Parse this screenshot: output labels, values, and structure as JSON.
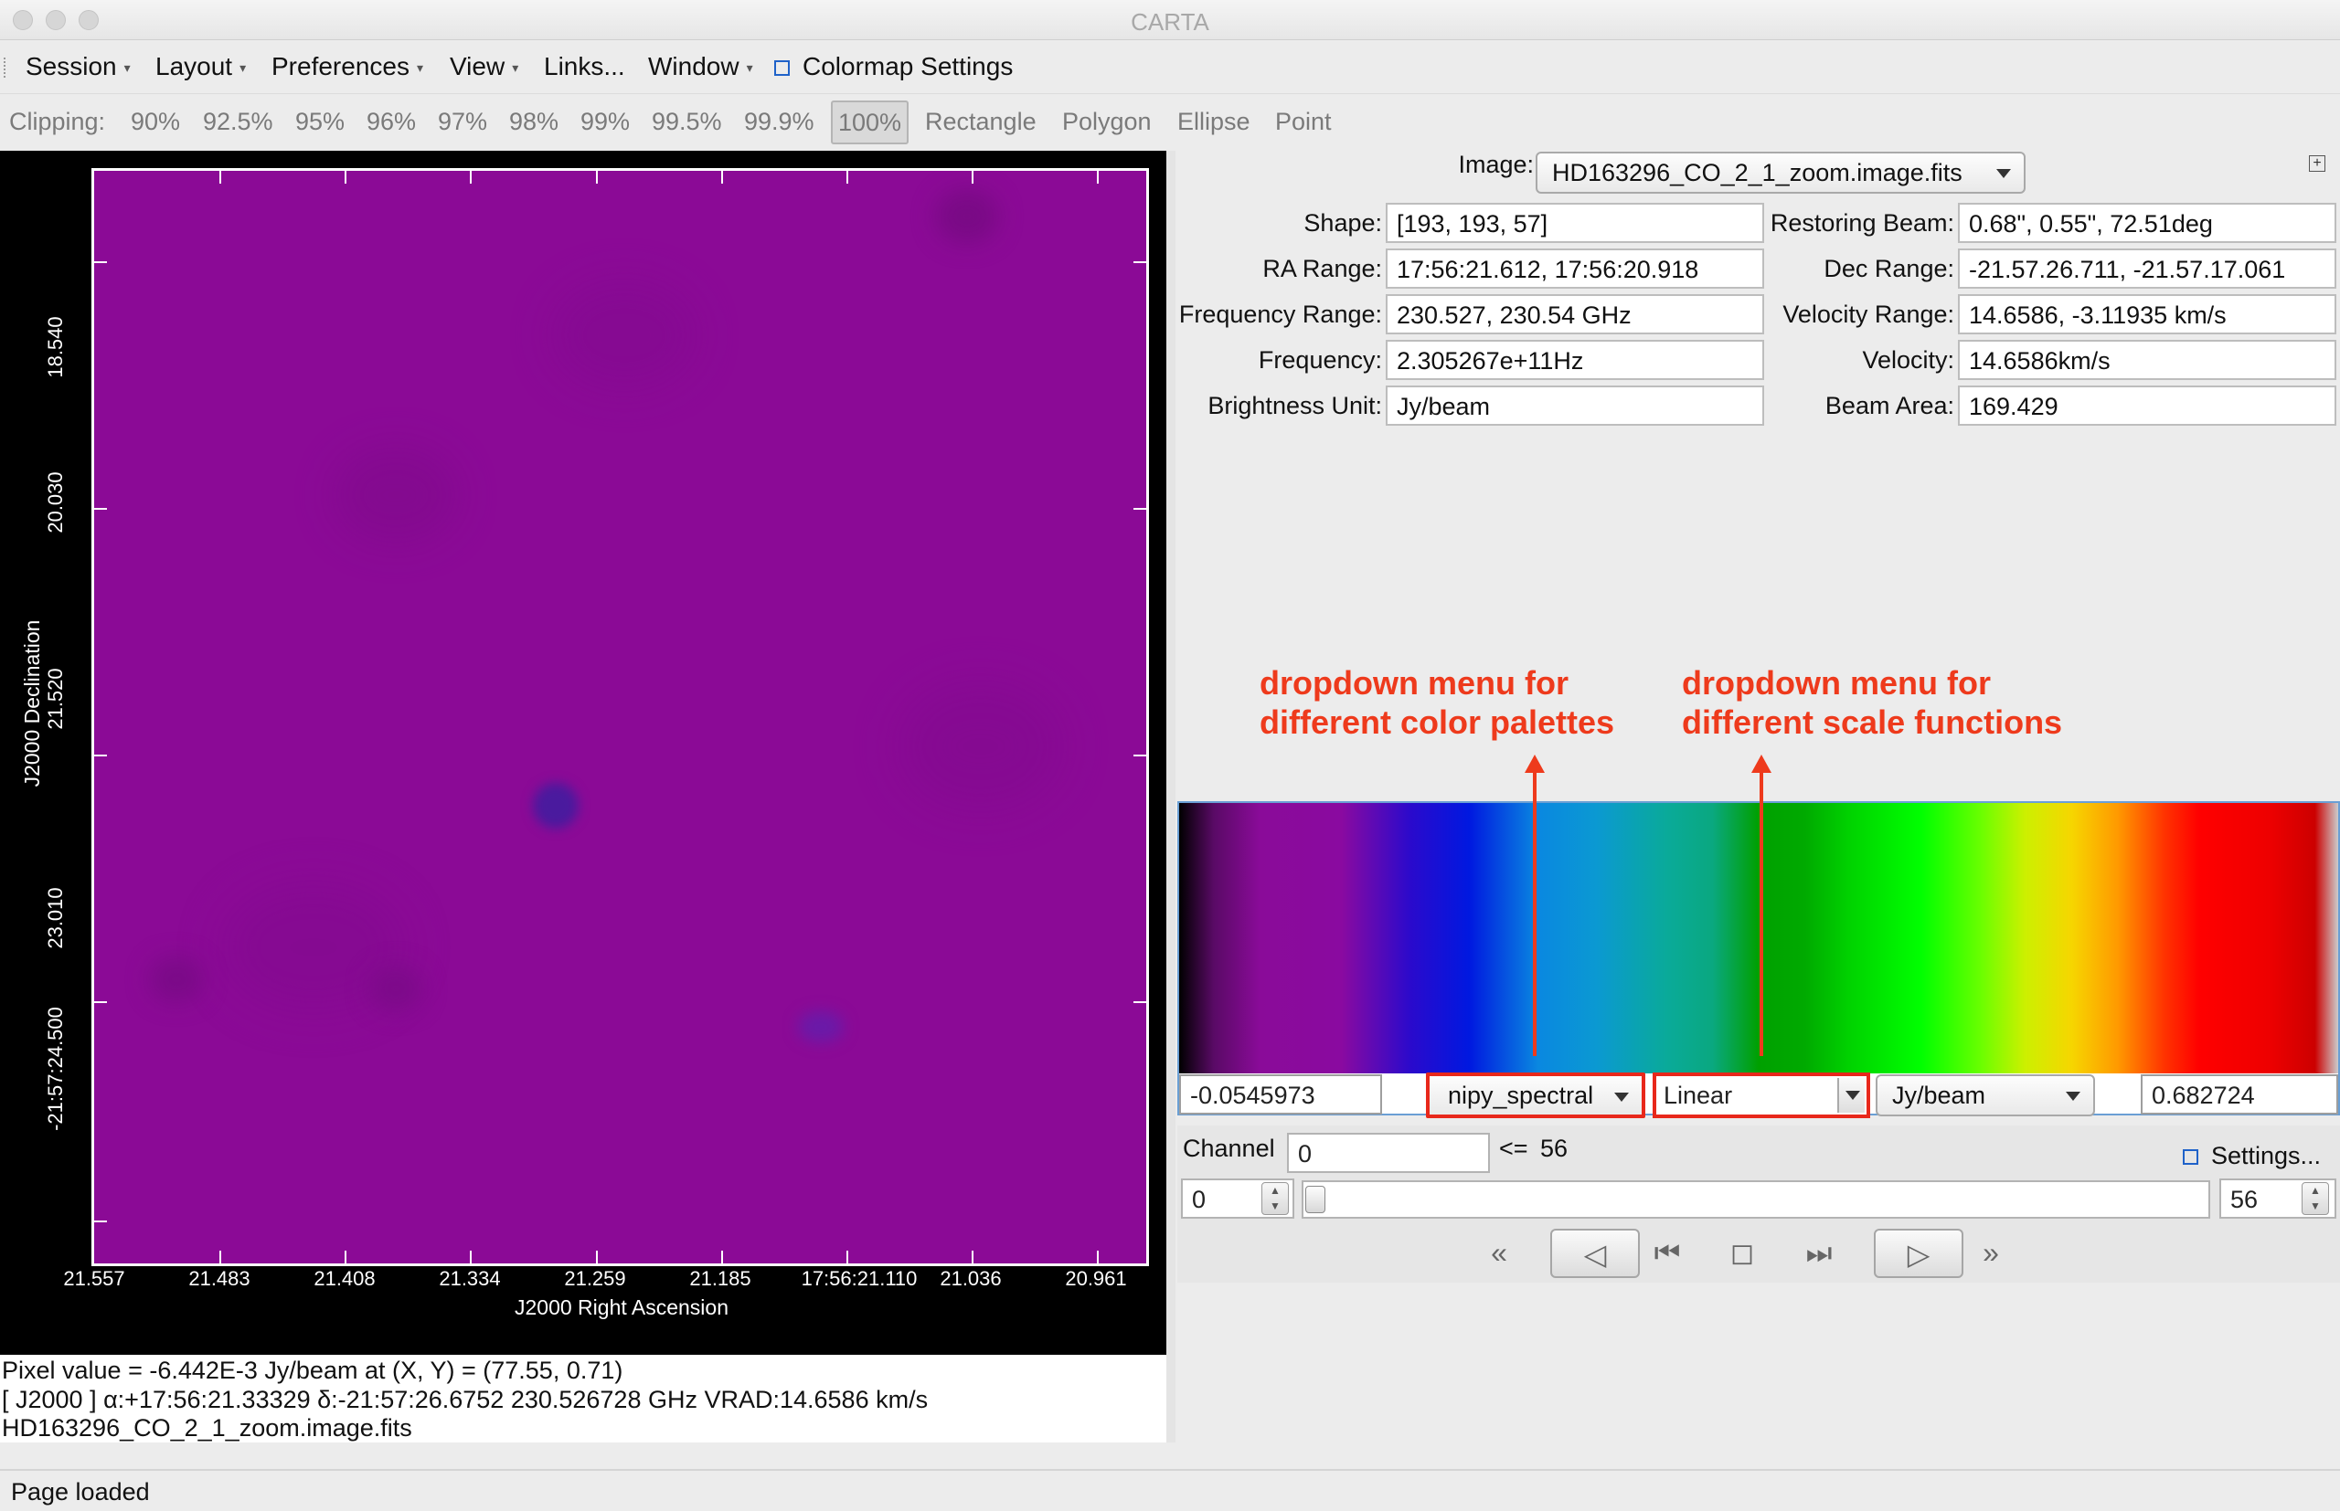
{
  "window": {
    "title": "CARTA"
  },
  "menubar": {
    "items": [
      {
        "label": "Session",
        "has_caret": true
      },
      {
        "label": "Layout",
        "has_caret": true
      },
      {
        "label": "Preferences",
        "has_caret": true
      },
      {
        "label": "View",
        "has_caret": true
      },
      {
        "label": "Links...",
        "has_caret": false
      },
      {
        "label": "Window",
        "has_caret": true
      }
    ],
    "colormap_settings_label": "Colormap Settings"
  },
  "clipping": {
    "label": "Clipping:",
    "percents": [
      "90%",
      "92.5%",
      "95%",
      "96%",
      "97%",
      "98%",
      "99%",
      "99.5%",
      "99.9%",
      "100%"
    ],
    "selected": "100%",
    "regions": [
      "Rectangle",
      "Polygon",
      "Ellipse",
      "Point"
    ]
  },
  "viewer": {
    "background_color": "#8b0a96",
    "x_ticks": [
      "21.557",
      "21.483",
      "21.408",
      "21.334",
      "21.259",
      "21.185",
      "17:56:21.110",
      "21.036",
      "20.961"
    ],
    "y_ticks": [
      "18.540",
      "20.030",
      "21.520",
      "23.010",
      "-21:57:24.500"
    ],
    "x_axis_title": "J2000 Right Ascension",
    "y_axis_title": "J2000 Declination"
  },
  "pixel_info": {
    "line1": "Pixel value = -6.442E-3 Jy/beam at (X, Y) = (77.55, 0.71)",
    "line2": "[ J2000 ] α:+17:56:21.33329 δ:-21:57:26.6752 230.526728 GHz VRAD:14.6586 km/s",
    "line3": "HD163296_CO_2_1_zoom.image.fits"
  },
  "image_info": {
    "image_label": "Image:",
    "image_value": "HD163296_CO_2_1_zoom.image.fits",
    "left_fields": [
      {
        "label": "Shape:",
        "value": "[193, 193, 57]"
      },
      {
        "label": "RA Range:",
        "value": "17:56:21.612, 17:56:20.918"
      },
      {
        "label": "Frequency Range:",
        "value": "230.527, 230.54 GHz"
      },
      {
        "label": "Frequency:",
        "value": "2.305267e+11Hz"
      },
      {
        "label": "Brightness Unit:",
        "value": "Jy/beam"
      }
    ],
    "right_fields": [
      {
        "label": "Restoring Beam:",
        "value": "0.68\", 0.55\", 72.51deg"
      },
      {
        "label": "Dec Range:",
        "value": "-21.57.26.711, -21.57.17.061"
      },
      {
        "label": "Velocity Range:",
        "value": "14.6586, -3.11935 km/s"
      },
      {
        "label": "Velocity:",
        "value": "14.6586km/s"
      },
      {
        "label": "Beam Area:",
        "value": "169.429"
      }
    ]
  },
  "annotations": {
    "palette_line1": "dropdown menu for",
    "palette_line2": "different color palettes",
    "scale_line1": "dropdown menu for",
    "scale_line2": "different scale functions",
    "color": "#ee3a1c"
  },
  "colormap": {
    "min_value": "-0.0545973",
    "palette": "nipy_spectral",
    "scale": "Linear",
    "unit": "Jy/beam",
    "max_value": "0.682724"
  },
  "animator": {
    "channel_label": "Channel",
    "channel_value": "0",
    "max_label": "<=",
    "max_value": "56",
    "settings_label": "Settings...",
    "start_value": "0",
    "end_value": "56",
    "slider_position": 0
  },
  "status": {
    "text": "Page loaded"
  }
}
